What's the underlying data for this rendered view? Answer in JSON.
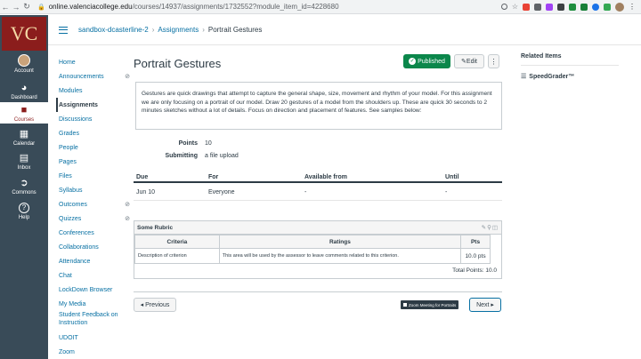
{
  "browser": {
    "back_icon": "arrow-left-icon",
    "url_domain": "online.valenciacollege.edu",
    "url_path": "/courses/14937/assignments/1732552?module_item_id=4228680"
  },
  "global_nav": {
    "logo": "VC",
    "items": [
      {
        "label": "Account",
        "icon": "avatar"
      },
      {
        "label": "Dashboard",
        "icon": "dashboard-icon"
      },
      {
        "label": "Courses",
        "icon": "book-icon"
      },
      {
        "label": "Calendar",
        "icon": "calendar-icon"
      },
      {
        "label": "Inbox",
        "icon": "inbox-icon"
      },
      {
        "label": "Commons",
        "icon": "commons-icon"
      },
      {
        "label": "Help",
        "icon": "help-icon"
      }
    ]
  },
  "breadcrumb": {
    "course": "sandbox-dcasterline-2",
    "section": "Assignments",
    "current": "Portrait Gestures"
  },
  "course_nav": {
    "items": [
      {
        "label": "Home"
      },
      {
        "label": "Announcements"
      },
      {
        "label": "Modules"
      },
      {
        "label": "Assignments"
      },
      {
        "label": "Discussions"
      },
      {
        "label": "Grades"
      },
      {
        "label": "People"
      },
      {
        "label": "Pages"
      },
      {
        "label": "Files"
      },
      {
        "label": "Syllabus"
      },
      {
        "label": "Outcomes"
      },
      {
        "label": "Quizzes"
      },
      {
        "label": "Conferences"
      },
      {
        "label": "Collaborations"
      },
      {
        "label": "Attendance"
      },
      {
        "label": "Chat"
      },
      {
        "label": "LockDown Browser"
      },
      {
        "label": "My Media"
      },
      {
        "label": "Student Feedback on Instruction"
      },
      {
        "label": "UDOIT"
      },
      {
        "label": "Zoom"
      }
    ]
  },
  "assignment": {
    "title": "Portrait Gestures",
    "published_label": "Published",
    "edit_label": "Edit",
    "more_label": "⋮",
    "description": "Gestures are quick drawings that attempt to capture the general shape, size, movement and rhythm of your model.  For this assignment we are only focusing on a portrait of our model.  Draw 20 gestures of a model from the shoulders up.  These are quick 30 seconds to 2 minutes sketches without a lot of details. Focus on direction and placement of features.  See samples below:",
    "points_label": "Points",
    "points_value": "10",
    "submitting_label": "Submitting",
    "submitting_value": "a file upload",
    "dates_headers": [
      "Due",
      "For",
      "Available from",
      "Until"
    ],
    "dates_row": [
      "Jun 10",
      "Everyone",
      "-",
      "-"
    ]
  },
  "rubric": {
    "title": "Some Rubric",
    "headers": [
      "Criteria",
      "Ratings",
      "Pts"
    ],
    "row": [
      "Description of criterion",
      "This area will be used by the assessor to leave comments related to this criterion.",
      "10.0 pts"
    ],
    "total": "Total Points: 10.0"
  },
  "pager": {
    "previous": "◂ Previous",
    "tooltip": "Zoom Meeting for Portraits",
    "next": "Next ▸"
  },
  "related": {
    "heading": "Related Items",
    "link": "SpeedGrader™"
  }
}
